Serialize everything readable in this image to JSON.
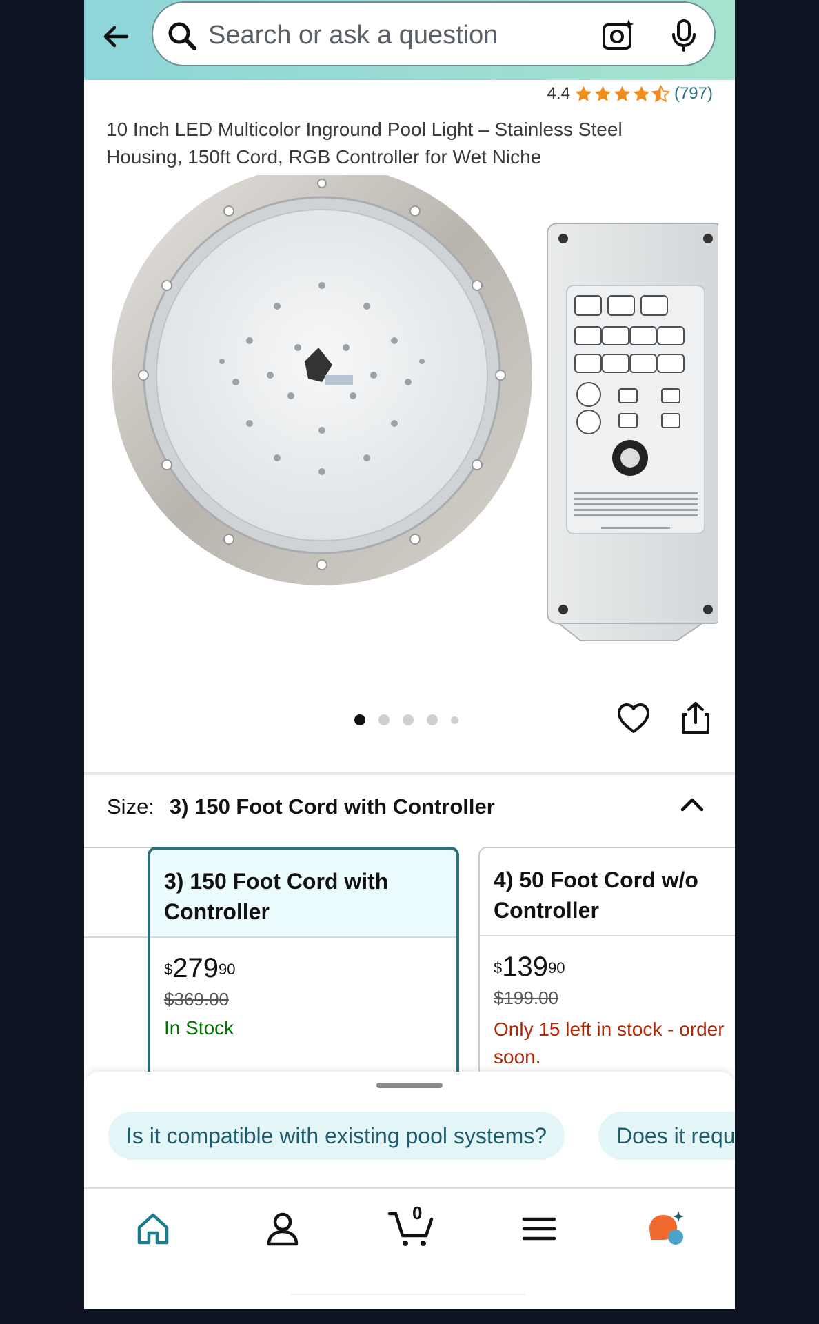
{
  "search": {
    "placeholder": "Search or ask a question"
  },
  "product": {
    "rating": "4.4",
    "rating_count": "(797)",
    "stars_value": 4.5,
    "title": "10 Inch LED Multicolor Inground Pool Light – Stainless Steel Housing, 150ft Cord, RGB Controller for Wet Niche"
  },
  "carousel": {
    "total_images": 5,
    "active_index": 0
  },
  "size": {
    "label": "Size:",
    "value": "3) 150 Foot Cord with Controller"
  },
  "options": [
    {
      "name_line1": "3) 150 Foot Cord with",
      "name_line2": "Controller",
      "currency": "$",
      "price_whole": "279",
      "price_fraction": "90",
      "list_price": "$369.00",
      "availability": "In Stock",
      "selected": true
    },
    {
      "name_line1": "4) 50 Foot Cord w/o",
      "name_line2": "Controller",
      "currency": "$",
      "price_whole": "139",
      "price_fraction": "90",
      "list_price": "$199.00",
      "availability_line1": "Only 15 left in stock - order",
      "availability_line2": "soon.",
      "selected": false
    }
  ],
  "questions": [
    "Is it compatible with existing pool systems?",
    "Does it requ"
  ],
  "cart": {
    "count": "0"
  },
  "colors": {
    "header_gradient_start": "#8fd5d9",
    "header_gradient_end": "#a6e3cf",
    "selected_border": "#2f6f7c",
    "in_stock": "#007600",
    "low_stock": "#b12704",
    "star": "#f08b1d",
    "chip_bg": "#e4f5f8"
  },
  "icons": [
    "back-arrow-icon",
    "search-icon",
    "camera-icon",
    "mic-icon",
    "star-icon",
    "heart-icon",
    "share-icon",
    "chevron-up-icon",
    "home-icon",
    "account-icon",
    "cart-icon",
    "menu-icon",
    "assistant-icon"
  ]
}
